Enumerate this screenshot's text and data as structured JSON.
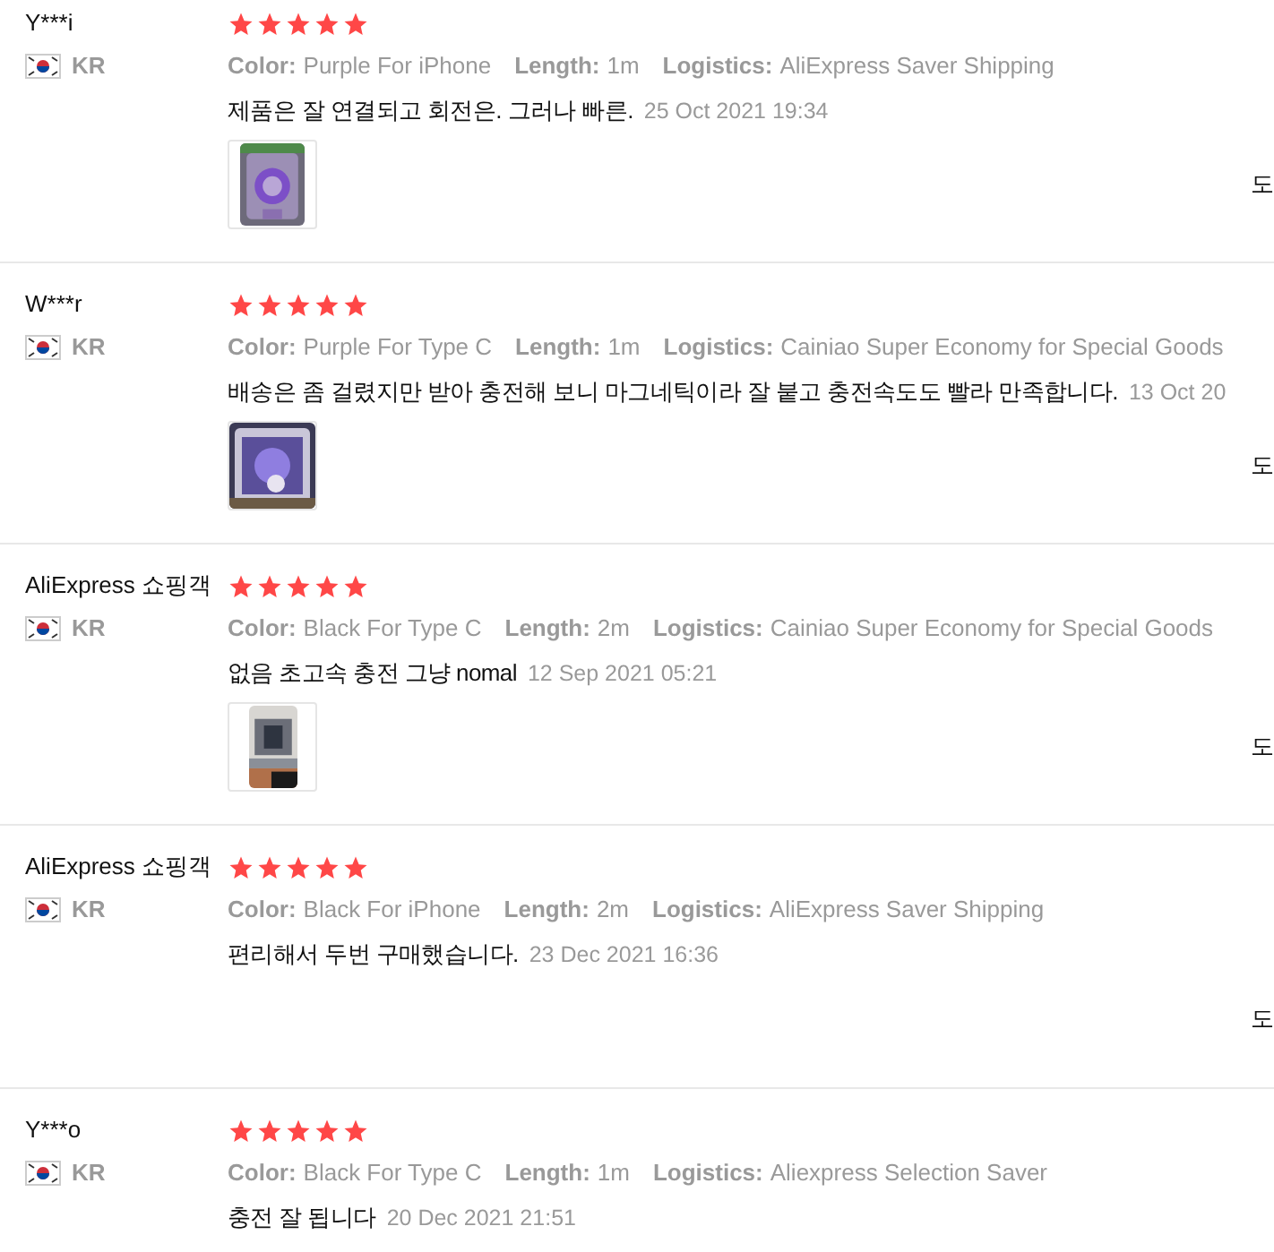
{
  "reviews": [
    {
      "name": "Y***i",
      "country": "KR",
      "stars": 5,
      "attributes": [
        {
          "label": "Color:",
          "value": "Purple For iPhone"
        },
        {
          "label": "Length:",
          "value": "1m"
        },
        {
          "label": "Logistics:",
          "value": "AliExpress Saver Shipping"
        }
      ],
      "comment": "제품은 잘 연결되고 회전은. 그러나 빠른.",
      "date": "25 Oct 2021 19:34",
      "side_text": "도"
    },
    {
      "name": "W***r",
      "country": "KR",
      "stars": 5,
      "attributes": [
        {
          "label": "Color:",
          "value": "Purple For Type C"
        },
        {
          "label": "Length:",
          "value": "1m"
        },
        {
          "label": "Logistics:",
          "value": "Cainiao Super Economy for Special Goods"
        }
      ],
      "comment": "배송은 좀 걸렸지만 받아 충전해 보니 마그네틱이라 잘 붙고 충전속도도 빨라 만족합니다.",
      "date": "13 Oct 20",
      "side_text": "도"
    },
    {
      "name": "AliExpress 쇼핑객",
      "country": "KR",
      "stars": 5,
      "attributes": [
        {
          "label": "Color:",
          "value": "Black For Type C"
        },
        {
          "label": "Length:",
          "value": "2m"
        },
        {
          "label": "Logistics:",
          "value": "Cainiao Super Economy for Special Goods"
        }
      ],
      "comment": "없음 초고속 충전 그냥 nomal",
      "date": "12 Sep 2021 05:21",
      "side_text": "도"
    },
    {
      "name": "AliExpress 쇼핑객",
      "country": "KR",
      "stars": 5,
      "attributes": [
        {
          "label": "Color:",
          "value": "Black For iPhone"
        },
        {
          "label": "Length:",
          "value": "2m"
        },
        {
          "label": "Logistics:",
          "value": "AliExpress Saver Shipping"
        }
      ],
      "comment": "편리해서 두번 구매했습니다.",
      "date": "23 Dec 2021 16:36",
      "side_text": "도"
    },
    {
      "name": "Y***o",
      "country": "KR",
      "stars": 5,
      "attributes": [
        {
          "label": "Color:",
          "value": "Black For Type C"
        },
        {
          "label": "Length:",
          "value": "1m"
        },
        {
          "label": "Logistics:",
          "value": "Aliexpress Selection Saver"
        }
      ],
      "comment": "충전 잘 됩니다",
      "date": "20 Dec 2021 21:51"
    }
  ]
}
